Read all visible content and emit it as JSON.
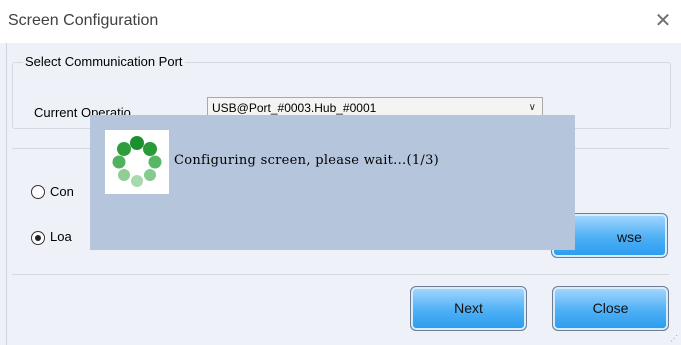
{
  "window": {
    "title": "Screen Configuration",
    "close_icon": "close-icon"
  },
  "port_group": {
    "legend": "Select Communication Port",
    "current_label": "Current Operatio",
    "port_value": "USB@Port_#0003.Hub_#0001"
  },
  "options": {
    "option1_label": "Con",
    "option1_checked": false,
    "option2_label": "Loa",
    "option2_checked": true,
    "browse_label": "wse"
  },
  "buttons": {
    "next_label": "Next",
    "close_label": "Close"
  },
  "progress_dialog": {
    "message": "Configuring screen, please wait...(1/3)",
    "spinner_icon": "loading-spinner-icon"
  },
  "colors": {
    "accent": "#2a9aee",
    "dialog_bg": "#b5c5dc",
    "spinner_green": "#2e9e3a"
  }
}
